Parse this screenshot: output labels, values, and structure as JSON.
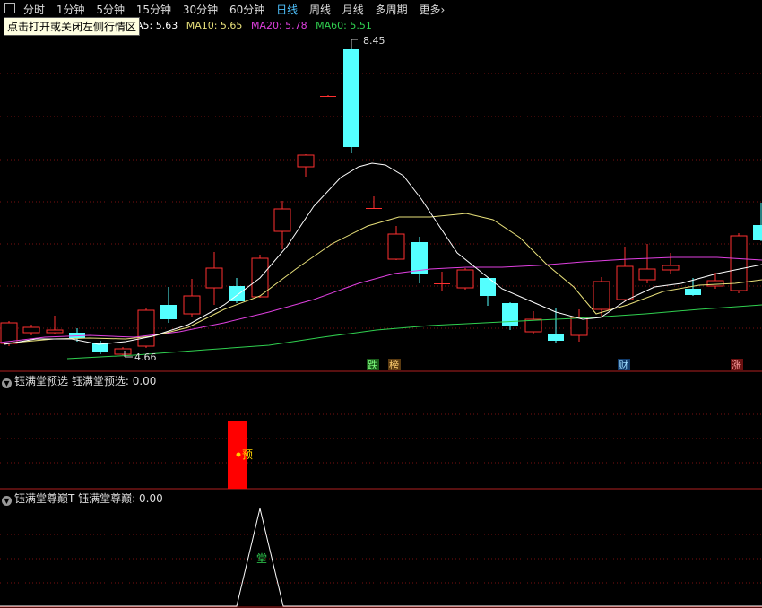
{
  "toolbar": {
    "tabs": [
      {
        "label": "分时",
        "active": false
      },
      {
        "label": "1分钟",
        "active": false
      },
      {
        "label": "5分钟",
        "active": false
      },
      {
        "label": "15分钟",
        "active": false
      },
      {
        "label": "30分钟",
        "active": false
      },
      {
        "label": "60分钟",
        "active": false
      },
      {
        "label": "日线",
        "active": true
      },
      {
        "label": "周线",
        "active": false
      },
      {
        "label": "月线",
        "active": false
      },
      {
        "label": "多周期",
        "active": false
      },
      {
        "label": "更多",
        "active": false
      }
    ],
    "more_arrow": "›",
    "tooltip": "点击打开或关闭左侧行情区"
  },
  "main_chart": {
    "ma_legend": {
      "ma5": "A5: 5.63",
      "ma10": "MA10: 5.65",
      "ma20": "MA20: 5.78",
      "ma60": "MA60: 5.51"
    },
    "high_label": "8.45",
    "low_label": "4.66",
    "markers": [
      "跌",
      "榜",
      "财",
      "涨"
    ],
    "colors": {
      "up": "#ff3030",
      "down": "#54ffff",
      "ma5": "#ffffff",
      "ma10": "#e8e07a",
      "ma20": "#e040e0",
      "ma60": "#30d050"
    }
  },
  "panel2": {
    "title": "钰满堂预选",
    "value_label": "钰满堂预选: 0.00",
    "bar_label": "预"
  },
  "panel3": {
    "title": "钰满堂尊巅T",
    "value_label": "钰满堂尊巅: 0.00",
    "peak_label": "堂"
  }
}
